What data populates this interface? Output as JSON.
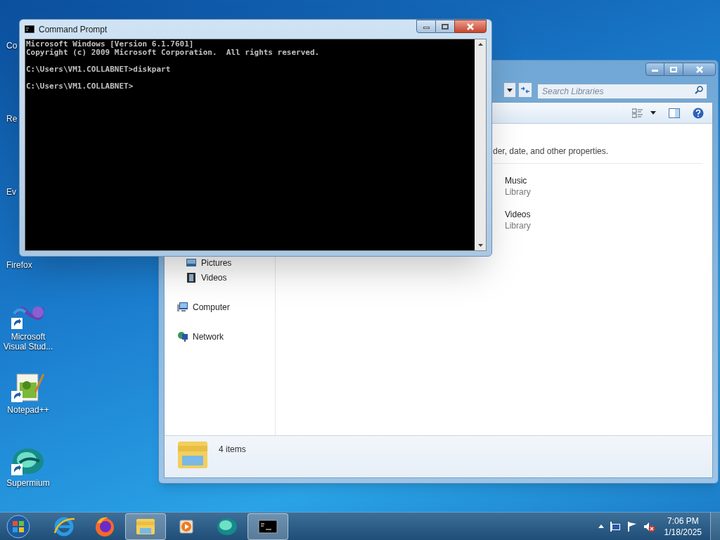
{
  "desktop_icons": [
    {
      "label": "Co",
      "kind": "covered"
    },
    {
      "label": "Re",
      "kind": "covered"
    },
    {
      "label": "Ev",
      "kind": "covered"
    },
    {
      "label": "Firefox",
      "kind": "covered_icon"
    },
    {
      "label": "Microsoft Visual Stud...",
      "kind": "visualstudio"
    },
    {
      "label": "Notepad++",
      "kind": "notepad"
    },
    {
      "label": "Supermium",
      "kind": "supermium"
    }
  ],
  "explorer": {
    "search": {
      "placeholder": "Search Libraries"
    },
    "hint": "der, date, and other properties.",
    "libraries": [
      {
        "name": "Music",
        "type": "Library"
      },
      {
        "name": "Videos",
        "type": "Library"
      }
    ],
    "nav": [
      {
        "label": "Pictures",
        "kind": "pictures"
      },
      {
        "label": "Videos",
        "kind": "videos"
      },
      {
        "label": "Computer",
        "kind": "computer"
      },
      {
        "label": "Network",
        "kind": "network"
      }
    ],
    "status": "4 items"
  },
  "console": {
    "title": "Command Prompt",
    "blocks": [
      [
        "Microsoft Windows [Version 6.1.7601]",
        "Copyright (c) 2009 Microsoft Corporation.  All rights reserved."
      ],
      [
        "C:\\Users\\VM1.COLLABNET>diskpart"
      ],
      [
        "C:\\Users\\VM1.COLLABNET>"
      ]
    ]
  },
  "taskbar": {
    "items": [
      {
        "kind": "start",
        "selected": false
      },
      {
        "kind": "ie",
        "selected": false
      },
      {
        "kind": "firefox",
        "selected": false
      },
      {
        "kind": "explorer",
        "selected": true
      },
      {
        "kind": "media",
        "selected": false
      },
      {
        "kind": "supermium",
        "selected": false
      },
      {
        "kind": "cmd",
        "selected": true
      }
    ],
    "clock": {
      "time": "7:06 PM",
      "date": "1/18/2025"
    }
  }
}
